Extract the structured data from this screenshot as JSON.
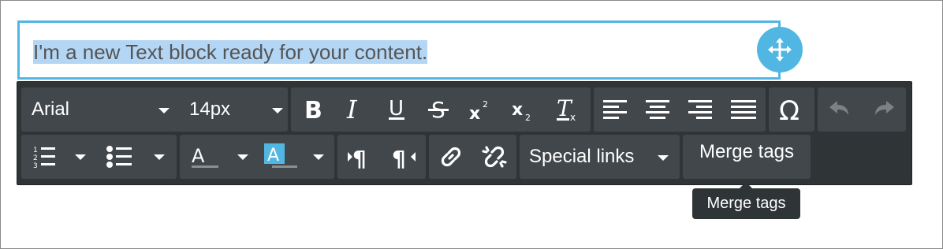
{
  "text_block": {
    "content": "I'm a new Text block ready for your content."
  },
  "toolbar": {
    "font_family": "Arial",
    "font_size": "14px",
    "special_links": "Special links",
    "merge_tags": "Merge tags"
  },
  "tooltip": {
    "text": "Merge tags"
  },
  "colors": {
    "accent": "#52b6e3",
    "toolbar_bg": "#2f3437",
    "button_bg": "#41474b",
    "selection": "#b4d6f5"
  },
  "icons": [
    "move-icon",
    "bold-icon",
    "italic-icon",
    "underline-icon",
    "strikethrough-icon",
    "superscript-icon",
    "subscript-icon",
    "clear-format-icon",
    "align-left-icon",
    "align-center-icon",
    "align-right-icon",
    "align-justify-icon",
    "omega-icon",
    "undo-icon",
    "redo-icon",
    "ordered-list-icon",
    "bullet-list-icon",
    "text-color-icon",
    "background-color-icon",
    "ltr-icon",
    "rtl-icon",
    "link-icon",
    "unlink-icon"
  ]
}
